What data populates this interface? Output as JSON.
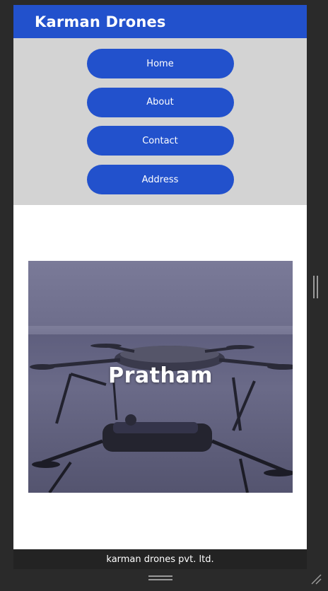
{
  "header": {
    "brand": "Karman Drones"
  },
  "nav": {
    "items": [
      {
        "label": "Home"
      },
      {
        "label": "About"
      },
      {
        "label": "Contact"
      },
      {
        "label": "Address"
      }
    ]
  },
  "hero": {
    "title": "Pratham",
    "image_icon": "drone-image"
  },
  "footer": {
    "text": "karman drones pvt. ltd."
  },
  "colors": {
    "primary": "#2251cc",
    "nav_background": "#d3d3d3",
    "footer_background": "#232323",
    "frame_background": "#2a2a2a"
  }
}
